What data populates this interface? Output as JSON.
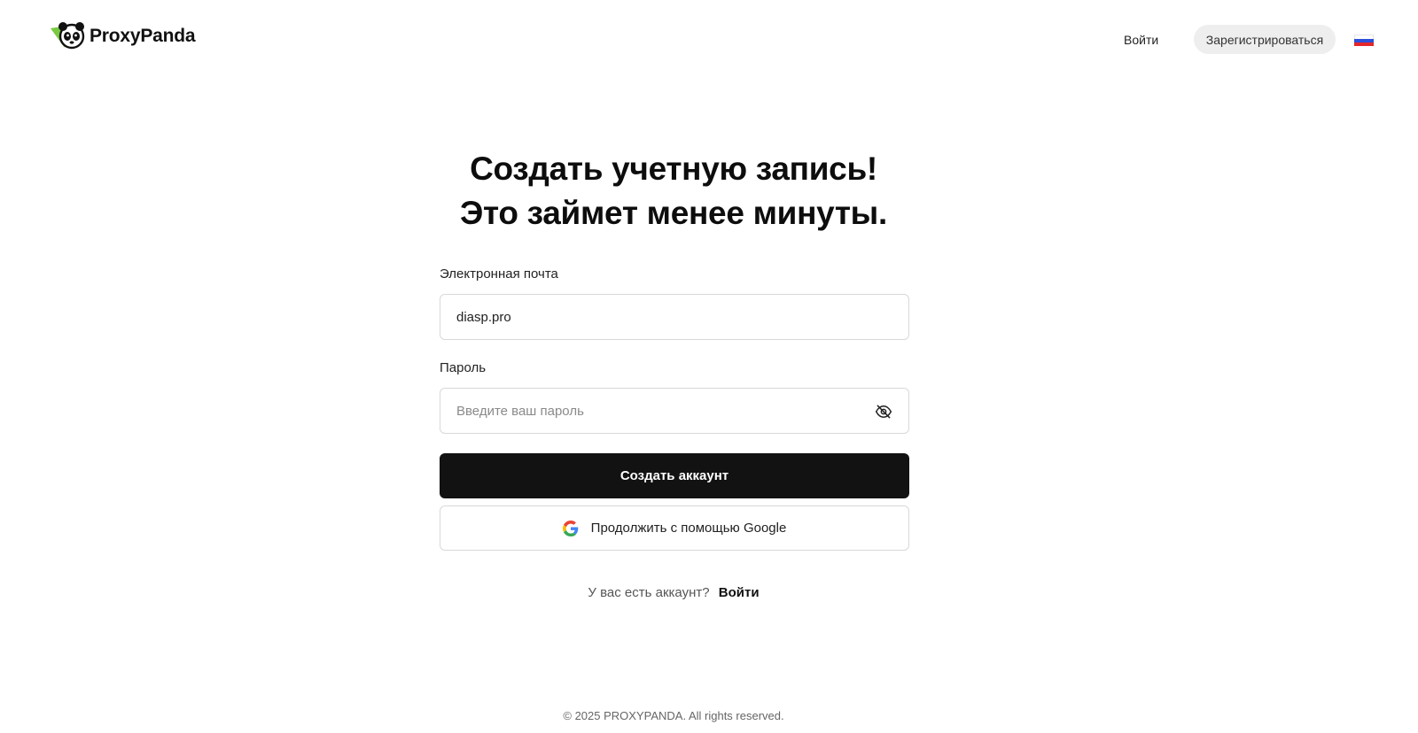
{
  "header": {
    "logo_text": "ProxyPanda",
    "login_label": "Войти",
    "register_label": "Зарегистрироваться",
    "language_icon": "russia-flag-icon"
  },
  "main": {
    "title_line1": "Создать учетную запись!",
    "title_line2": "Это займет менее минуты.",
    "email": {
      "label": "Электронная почта",
      "value": "diasp.pro"
    },
    "password": {
      "label": "Пароль",
      "placeholder": "Введите ваш пароль",
      "toggle_icon": "eye-off-icon"
    },
    "create_button": "Создать аккаунт",
    "google_button": "Продолжить с помощью Google",
    "google_icon": "google-icon",
    "have_account_text": "У вас есть аккаунт?",
    "login_link": "Войти"
  },
  "footer": {
    "copyright": "© 2025 PROXYPANDA. All rights reserved."
  },
  "colors": {
    "primary_button": "#121212",
    "register_pill": "#eeeeee",
    "logo_green": "#7ac943"
  }
}
